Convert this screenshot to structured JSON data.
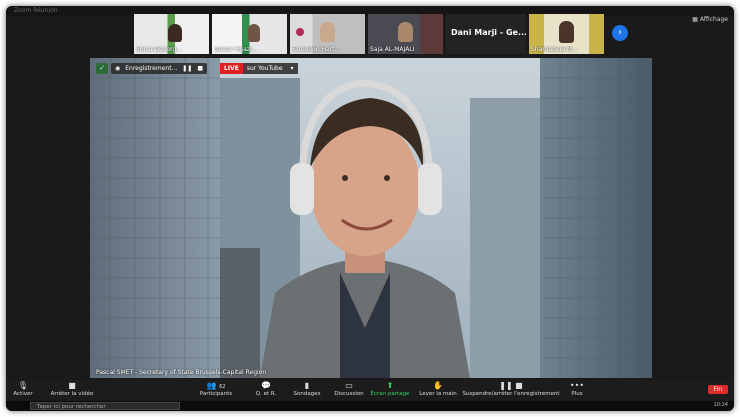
{
  "window": {
    "app_title": "Zoom Réunion",
    "view_label": "Affichage"
  },
  "participants_strip": [
    {
      "name": "Sonia Deverg..."
    },
    {
      "name": "Qaisar Hijazi..."
    },
    {
      "name": "Fareedon Hart..."
    },
    {
      "name": "Saja AL-MAJALI"
    },
    {
      "name": "Dani Marji - Ge..."
    },
    {
      "name": "Sharhabeel M..."
    }
  ],
  "main_video": {
    "recording_label": "Enregistrement...",
    "live_label": "LIVE",
    "stream_label": "sur YouTube",
    "caption": "Pascal SMET - Secretary of State Brussels-Capital Region"
  },
  "toolbar": {
    "mute": "Activer",
    "video": "Arrêter la vidéo",
    "participants": "Participants",
    "participants_count": "62",
    "qa": "Q. et R.",
    "polls": "Sondages",
    "chat": "Discussion",
    "share": "Écran partagé",
    "raise": "Lever la main",
    "record": "Suspendre/arrêter l'enregistrement",
    "more": "Plus",
    "end": "Fin"
  },
  "taskbar": {
    "search_placeholder": "Taper ici pour rechercher",
    "time": "10:24"
  },
  "colors": {
    "accent": "#1e73e8",
    "live": "#e02020",
    "share": "#32d35a",
    "end": "#e02b2b"
  }
}
